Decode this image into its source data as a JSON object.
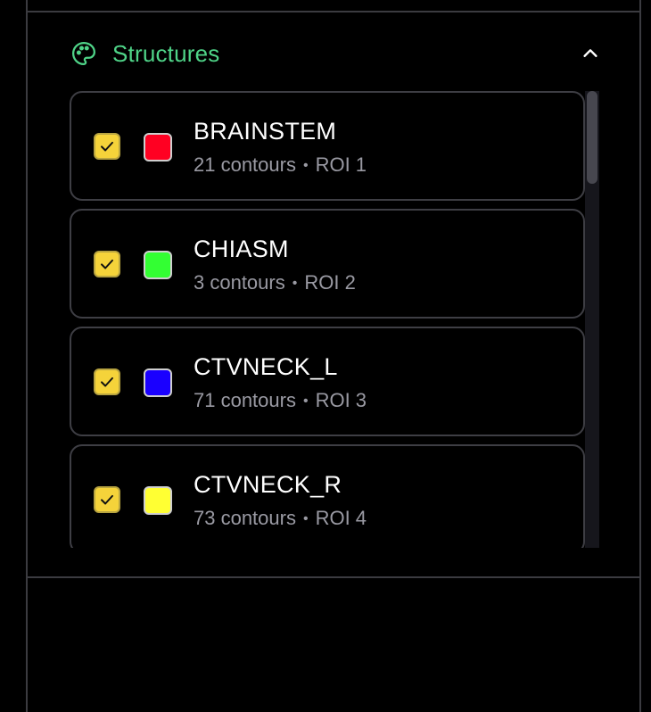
{
  "structures": {
    "title": "Structures",
    "header_icon": "palette-icon",
    "collapse_icon": "chevron-up-icon",
    "accent_color": "#4fd488",
    "items": [
      {
        "name": "BRAINSTEM",
        "contours": "21 contours",
        "roi": "ROI 1",
        "color": "#ff0022",
        "checked": true
      },
      {
        "name": "CHIASM",
        "contours": "3 contours",
        "roi": "ROI 2",
        "color": "#33ff33",
        "checked": true
      },
      {
        "name": "CTVNECK_L",
        "contours": "71 contours",
        "roi": "ROI 3",
        "color": "#1a00ff",
        "checked": true
      },
      {
        "name": "CTVNECK_R",
        "contours": "73 contours",
        "roi": "ROI 4",
        "color": "#ffff33",
        "checked": true
      }
    ]
  }
}
